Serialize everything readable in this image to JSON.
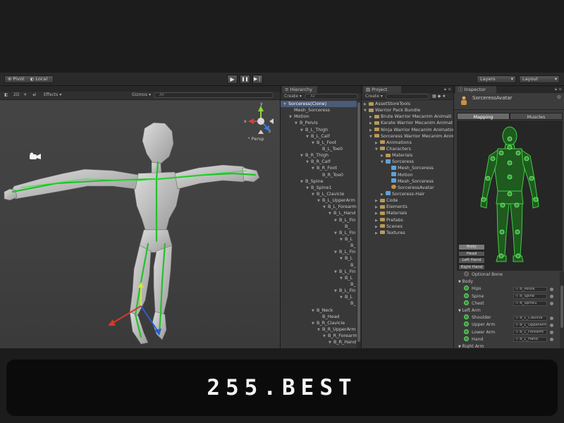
{
  "toolbar": {
    "pivot": "Pivot",
    "local": "Local",
    "play": "▶",
    "pause": "❚❚",
    "step": "▶❘",
    "layers": "Layers",
    "layout": "Layout"
  },
  "scene": {
    "mode_2d": "2D",
    "effects": "Effects",
    "gizmos": "Gizmos",
    "search_placeholder": "All",
    "gizmo_y": "y",
    "gizmo_x": "x",
    "gizmo_z": "z",
    "persp": "Persp"
  },
  "hierarchy": {
    "tab": "Hierarchy",
    "create": "Create",
    "search_placeholder": "All",
    "items": [
      {
        "label": "Sorceress(Clone)",
        "depth": 0,
        "arrow": "▼",
        "sel": true
      },
      {
        "label": "Mesh_Sorceress",
        "depth": 1,
        "arrow": ""
      },
      {
        "label": "Motion",
        "depth": 1,
        "arrow": "▼"
      },
      {
        "label": "B_Pelvis",
        "depth": 2,
        "arrow": "▼"
      },
      {
        "label": "B_L_Thigh",
        "depth": 3,
        "arrow": "▼"
      },
      {
        "label": "B_L_Calf",
        "depth": 4,
        "arrow": "▼"
      },
      {
        "label": "B_L_Foot",
        "depth": 5,
        "arrow": "▼"
      },
      {
        "label": "B_L_Toe0",
        "depth": 6,
        "arrow": ""
      },
      {
        "label": "B_R_Thigh",
        "depth": 3,
        "arrow": "▼"
      },
      {
        "label": "B_R_Calf",
        "depth": 4,
        "arrow": "▼"
      },
      {
        "label": "B_R_Foot",
        "depth": 5,
        "arrow": "▼"
      },
      {
        "label": "B_R_Toe0",
        "depth": 6,
        "arrow": ""
      },
      {
        "label": "B_Spine",
        "depth": 3,
        "arrow": "▼"
      },
      {
        "label": "B_Spine1",
        "depth": 4,
        "arrow": "▼"
      },
      {
        "label": "B_L_Clavicle",
        "depth": 5,
        "arrow": "▼"
      },
      {
        "label": "B_L_UpperArm",
        "depth": 6,
        "arrow": "▼"
      },
      {
        "label": "B_L_Forearm",
        "depth": 7,
        "arrow": "▼"
      },
      {
        "label": "B_L_Hand",
        "depth": 8,
        "arrow": "▼"
      },
      {
        "label": "B_L_Fin",
        "depth": 9,
        "arrow": "▼"
      },
      {
        "label": "B_",
        "depth": 10,
        "arrow": ""
      },
      {
        "label": "B_L_Fin",
        "depth": 9,
        "arrow": "▼"
      },
      {
        "label": "B_L",
        "depth": 10,
        "arrow": "▼"
      },
      {
        "label": "B_",
        "depth": 11,
        "arrow": ""
      },
      {
        "label": "B_L_Fin",
        "depth": 9,
        "arrow": "▼"
      },
      {
        "label": "B_L",
        "depth": 10,
        "arrow": "▼"
      },
      {
        "label": "B_",
        "depth": 11,
        "arrow": ""
      },
      {
        "label": "B_L_Fin",
        "depth": 9,
        "arrow": "▼"
      },
      {
        "label": "B_L",
        "depth": 10,
        "arrow": "▼"
      },
      {
        "label": "B_",
        "depth": 11,
        "arrow": ""
      },
      {
        "label": "B_L_Fin",
        "depth": 9,
        "arrow": "▼"
      },
      {
        "label": "B_L",
        "depth": 10,
        "arrow": "▼"
      },
      {
        "label": "B_",
        "depth": 11,
        "arrow": ""
      },
      {
        "label": "B_Neck",
        "depth": 5,
        "arrow": "▼"
      },
      {
        "label": "B_Head",
        "depth": 6,
        "arrow": ""
      },
      {
        "label": "B_R_Clavicle",
        "depth": 5,
        "arrow": "▼"
      },
      {
        "label": "B_R_UpperArm",
        "depth": 6,
        "arrow": "▼"
      },
      {
        "label": "B_R_Forearm",
        "depth": 7,
        "arrow": "▼"
      },
      {
        "label": "B_R_Hand",
        "depth": 8,
        "arrow": "▼"
      }
    ]
  },
  "project": {
    "tab": "Project",
    "create": "Create",
    "items": [
      {
        "label": "AssetStoreTools",
        "depth": 0,
        "arrow": "▶",
        "icon": "folder"
      },
      {
        "label": "Warrior Pack Bundle",
        "depth": 0,
        "arrow": "▼",
        "icon": "folder"
      },
      {
        "label": "Brute Warrior Mecanim Animati",
        "depth": 1,
        "arrow": "▶",
        "icon": "folder"
      },
      {
        "label": "Karate Warrior Mecanim Animat",
        "depth": 1,
        "arrow": "▶",
        "icon": "folder"
      },
      {
        "label": "Ninja Warrior Mecanim Animatio",
        "depth": 1,
        "arrow": "▶",
        "icon": "folder"
      },
      {
        "label": "Sorceress Warrior Mecanim Anim",
        "depth": 1,
        "arrow": "▼",
        "icon": "folder"
      },
      {
        "label": "Animations",
        "depth": 2,
        "arrow": "▶",
        "icon": "folder"
      },
      {
        "label": "Characters",
        "depth": 2,
        "arrow": "▼",
        "icon": "folder"
      },
      {
        "label": "Materials",
        "depth": 3,
        "arrow": "▶",
        "icon": "folder"
      },
      {
        "label": "Sorceress",
        "depth": 3,
        "arrow": "▼",
        "icon": "prefab"
      },
      {
        "label": "Mesh_Sorceress",
        "depth": 4,
        "arrow": "",
        "icon": "prefab"
      },
      {
        "label": "Motion",
        "depth": 4,
        "arrow": "",
        "icon": "prefab"
      },
      {
        "label": "Mesh_Sorceress",
        "depth": 4,
        "arrow": "",
        "icon": "prefab"
      },
      {
        "label": "SorceressAvatar",
        "depth": 4,
        "arrow": "",
        "icon": "avatar"
      },
      {
        "label": "Sorceress-Hair",
        "depth": 3,
        "arrow": "▶",
        "icon": "prefab"
      },
      {
        "label": "Code",
        "depth": 2,
        "arrow": "▶",
        "icon": "folder"
      },
      {
        "label": "Elements",
        "depth": 2,
        "arrow": "▶",
        "icon": "folder"
      },
      {
        "label": "Materials",
        "depth": 2,
        "arrow": "▶",
        "icon": "folder"
      },
      {
        "label": "Prefabs",
        "depth": 2,
        "arrow": "▶",
        "icon": "folder"
      },
      {
        "label": "Scenes",
        "depth": 2,
        "arrow": "▶",
        "icon": "folder"
      },
      {
        "label": "Textures",
        "depth": 2,
        "arrow": "▶",
        "icon": "folder"
      }
    ]
  },
  "inspector": {
    "tab": "Inspector",
    "asset_name": "SorceressAvatar",
    "tabs": [
      "Mapping",
      "Muscles"
    ],
    "body_buttons": [
      "Body",
      "Head",
      "Left Hand",
      "Right Hand"
    ],
    "bones": [
      {
        "type": "item",
        "dot": "empty",
        "label": "Optional Bone"
      },
      {
        "type": "section",
        "label": "Body"
      },
      {
        "type": "item",
        "dot": "on",
        "label": "Hips",
        "value": "B_Pelvis"
      },
      {
        "type": "item",
        "dot": "on",
        "label": "Spine",
        "value": "B_Spine"
      },
      {
        "type": "item",
        "dot": "on",
        "label": "Chest",
        "value": "B_Spine1"
      },
      {
        "type": "section",
        "label": "Left Arm"
      },
      {
        "type": "item",
        "dot": "on",
        "label": "Shoulder",
        "value": "B_L_Clavicle"
      },
      {
        "type": "item",
        "dot": "on",
        "label": "Upper Arm",
        "value": "B_L_UpperArm"
      },
      {
        "type": "item",
        "dot": "on",
        "label": "Lower Arm",
        "value": "B_L_Forearm"
      },
      {
        "type": "item",
        "dot": "on",
        "label": "Hand",
        "value": "B_L_Hand"
      },
      {
        "type": "section",
        "label": "Right Arm"
      }
    ]
  },
  "banner": {
    "text": "255.BEST"
  },
  "colors": {
    "bone_green": "#22c22a",
    "selection": "#4a5a78",
    "mesh": "#c9c9c9"
  }
}
